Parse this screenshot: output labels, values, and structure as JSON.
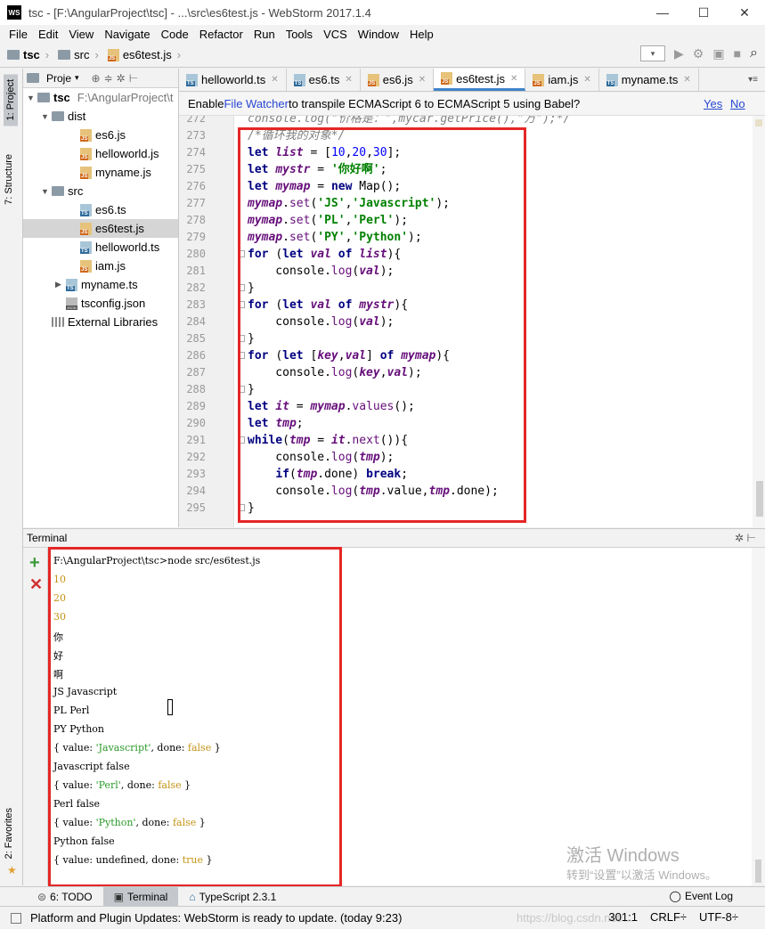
{
  "window": {
    "logo": "WS",
    "title": "tsc - [F:\\AngularProject\\tsc] - ...\\src\\es6test.js - WebStorm 2017.1.4",
    "minimize": "—",
    "maximize": "☐",
    "close": "✕"
  },
  "menu": [
    "File",
    "Edit",
    "View",
    "Navigate",
    "Code",
    "Refactor",
    "Run",
    "Tools",
    "VCS",
    "Window",
    "Help"
  ],
  "breadcrumb": [
    "tsc",
    "src",
    "es6test.js"
  ],
  "left_strip": {
    "project": "1: Project",
    "structure": "7: Structure",
    "favorites": "2: Favorites"
  },
  "project": {
    "header": "Proje",
    "root_name": "tsc",
    "root_path": "F:\\AngularProject\\t",
    "tree": [
      {
        "label": "dist",
        "type": "folder",
        "indent": 1,
        "arrow": "▼"
      },
      {
        "label": "es6.js",
        "type": "js",
        "indent": 3,
        "arrow": ""
      },
      {
        "label": "helloworld.js",
        "type": "js",
        "indent": 3,
        "arrow": ""
      },
      {
        "label": "myname.js",
        "type": "js",
        "indent": 3,
        "arrow": ""
      },
      {
        "label": "src",
        "type": "folder",
        "indent": 1,
        "arrow": "▼"
      },
      {
        "label": "es6.ts",
        "type": "ts",
        "indent": 3,
        "arrow": ""
      },
      {
        "label": "es6test.js",
        "type": "js",
        "indent": 3,
        "arrow": "",
        "selected": true
      },
      {
        "label": "helloworld.ts",
        "type": "ts",
        "indent": 3,
        "arrow": ""
      },
      {
        "label": "iam.js",
        "type": "js",
        "indent": 3,
        "arrow": ""
      },
      {
        "label": "myname.ts",
        "type": "ts",
        "indent": 2,
        "arrow": "▶"
      },
      {
        "label": "tsconfig.json",
        "type": "json",
        "indent": 2,
        "arrow": ""
      },
      {
        "label": "External Libraries",
        "type": "lib",
        "indent": 1,
        "arrow": ""
      }
    ]
  },
  "tabs": [
    {
      "label": "helloworld.ts",
      "type": "ts",
      "active": false
    },
    {
      "label": "es6.ts",
      "type": "ts",
      "active": false
    },
    {
      "label": "es6.js",
      "type": "js",
      "active": false
    },
    {
      "label": "es6test.js",
      "type": "js",
      "active": true
    },
    {
      "label": "iam.js",
      "type": "js",
      "active": false
    },
    {
      "label": "myname.ts",
      "type": "ts",
      "active": false
    }
  ],
  "tab_more": "▾≡",
  "notification": {
    "prefix": "Enable ",
    "link": "File Watcher",
    "suffix": " to transpile ECMAScript 6 to ECMAScript 5 using Babel?",
    "yes": "Yes",
    "no": "No"
  },
  "code": [
    {
      "n": "272",
      "tokens": [
        [
          "cmt",
          "console.log(\"价格是：\",mycar.getPrice(),\"万\");*/"
        ]
      ]
    },
    {
      "n": "273",
      "tokens": [
        [
          "cmt",
          "/*循环我的对象*/"
        ]
      ]
    },
    {
      "n": "274",
      "tokens": [
        [
          "kw",
          "let "
        ],
        [
          "var",
          "list"
        ],
        [
          "plain",
          " = ["
        ],
        [
          "num",
          "10"
        ],
        [
          "plain",
          ","
        ],
        [
          "num",
          "20"
        ],
        [
          "plain",
          ","
        ],
        [
          "num",
          "30"
        ],
        [
          "plain",
          "];"
        ]
      ]
    },
    {
      "n": "275",
      "tokens": [
        [
          "kw",
          "let "
        ],
        [
          "var",
          "mystr"
        ],
        [
          "plain",
          " = "
        ],
        [
          "str",
          "'你好啊'"
        ],
        [
          "plain",
          ";"
        ]
      ]
    },
    {
      "n": "276",
      "tokens": [
        [
          "kw",
          "let "
        ],
        [
          "var",
          "mymap"
        ],
        [
          "plain",
          " = "
        ],
        [
          "kw",
          "new "
        ],
        [
          "plain",
          "Map();"
        ]
      ]
    },
    {
      "n": "277",
      "tokens": [
        [
          "var",
          "mymap"
        ],
        [
          "plain",
          "."
        ],
        [
          "fn",
          "set"
        ],
        [
          "plain",
          "("
        ],
        [
          "str",
          "'JS'"
        ],
        [
          "plain",
          ","
        ],
        [
          "str",
          "'Javascript'"
        ],
        [
          "plain",
          ");"
        ]
      ]
    },
    {
      "n": "278",
      "tokens": [
        [
          "var",
          "mymap"
        ],
        [
          "plain",
          "."
        ],
        [
          "fn",
          "set"
        ],
        [
          "plain",
          "("
        ],
        [
          "str",
          "'PL'"
        ],
        [
          "plain",
          ","
        ],
        [
          "str",
          "'Perl'"
        ],
        [
          "plain",
          ");"
        ]
      ]
    },
    {
      "n": "279",
      "tokens": [
        [
          "var",
          "mymap"
        ],
        [
          "plain",
          "."
        ],
        [
          "fn",
          "set"
        ],
        [
          "plain",
          "("
        ],
        [
          "str",
          "'PY'"
        ],
        [
          "plain",
          ","
        ],
        [
          "str",
          "'Python'"
        ],
        [
          "plain",
          ");"
        ]
      ]
    },
    {
      "n": "280",
      "tokens": [
        [
          "kw",
          "for "
        ],
        [
          "plain",
          "("
        ],
        [
          "kw",
          "let "
        ],
        [
          "var",
          "val"
        ],
        [
          "kw",
          " of "
        ],
        [
          "var",
          "list"
        ],
        [
          "plain",
          "){"
        ]
      ],
      "fold": true
    },
    {
      "n": "281",
      "tokens": [
        [
          "plain",
          "    console."
        ],
        [
          "fn",
          "log"
        ],
        [
          "plain",
          "("
        ],
        [
          "var",
          "val"
        ],
        [
          "plain",
          ");"
        ]
      ]
    },
    {
      "n": "282",
      "tokens": [
        [
          "plain",
          "}"
        ]
      ],
      "fold": true
    },
    {
      "n": "283",
      "tokens": [
        [
          "kw",
          "for "
        ],
        [
          "plain",
          "("
        ],
        [
          "kw",
          "let "
        ],
        [
          "var",
          "val"
        ],
        [
          "kw",
          " of "
        ],
        [
          "var",
          "mystr"
        ],
        [
          "plain",
          "){"
        ]
      ],
      "fold": true
    },
    {
      "n": "284",
      "tokens": [
        [
          "plain",
          "    console."
        ],
        [
          "fn",
          "log"
        ],
        [
          "plain",
          "("
        ],
        [
          "var",
          "val"
        ],
        [
          "plain",
          ");"
        ]
      ]
    },
    {
      "n": "285",
      "tokens": [
        [
          "plain",
          "}"
        ]
      ],
      "fold": true
    },
    {
      "n": "286",
      "tokens": [
        [
          "kw",
          "for "
        ],
        [
          "plain",
          "("
        ],
        [
          "kw",
          "let "
        ],
        [
          "plain",
          "["
        ],
        [
          "var",
          "key"
        ],
        [
          "plain",
          ","
        ],
        [
          "var",
          "val"
        ],
        [
          "plain",
          "]"
        ],
        [
          "kw",
          " of "
        ],
        [
          "var",
          "mymap"
        ],
        [
          "plain",
          "){"
        ]
      ],
      "fold": true
    },
    {
      "n": "287",
      "tokens": [
        [
          "plain",
          "    console."
        ],
        [
          "fn",
          "log"
        ],
        [
          "plain",
          "("
        ],
        [
          "var",
          "key"
        ],
        [
          "plain",
          ","
        ],
        [
          "var",
          "val"
        ],
        [
          "plain",
          ");"
        ]
      ]
    },
    {
      "n": "288",
      "tokens": [
        [
          "plain",
          "}"
        ]
      ],
      "fold": true
    },
    {
      "n": "289",
      "tokens": [
        [
          "kw",
          "let "
        ],
        [
          "var",
          "it"
        ],
        [
          "plain",
          " = "
        ],
        [
          "var",
          "mymap"
        ],
        [
          "plain",
          "."
        ],
        [
          "fn",
          "values"
        ],
        [
          "plain",
          "();"
        ]
      ]
    },
    {
      "n": "290",
      "tokens": [
        [
          "kw",
          "let "
        ],
        [
          "var",
          "tmp"
        ],
        [
          "plain",
          ";"
        ]
      ]
    },
    {
      "n": "291",
      "tokens": [
        [
          "kw",
          "while"
        ],
        [
          "plain",
          "("
        ],
        [
          "var",
          "tmp"
        ],
        [
          "plain",
          " = "
        ],
        [
          "var",
          "it"
        ],
        [
          "plain",
          "."
        ],
        [
          "fn",
          "next"
        ],
        [
          "plain",
          "()){"
        ]
      ],
      "fold": true
    },
    {
      "n": "292",
      "tokens": [
        [
          "plain",
          "    console."
        ],
        [
          "fn",
          "log"
        ],
        [
          "plain",
          "("
        ],
        [
          "var",
          "tmp"
        ],
        [
          "plain",
          ");"
        ]
      ]
    },
    {
      "n": "293",
      "tokens": [
        [
          "plain",
          "    "
        ],
        [
          "kw",
          "if"
        ],
        [
          "plain",
          "("
        ],
        [
          "var",
          "tmp"
        ],
        [
          "plain",
          ".done) "
        ],
        [
          "kw",
          "break"
        ],
        [
          "plain",
          ";"
        ]
      ]
    },
    {
      "n": "294",
      "tokens": [
        [
          "plain",
          "    console."
        ],
        [
          "fn",
          "log"
        ],
        [
          "plain",
          "("
        ],
        [
          "var",
          "tmp"
        ],
        [
          "plain",
          ".value,"
        ],
        [
          "var",
          "tmp"
        ],
        [
          "plain",
          ".done);"
        ]
      ]
    },
    {
      "n": "295",
      "tokens": [
        [
          "plain",
          "}"
        ]
      ],
      "fold": true
    }
  ],
  "terminal": {
    "title": "Terminal",
    "header_icons": "✲ ⊢",
    "add": "+",
    "close": "✕",
    "lines": [
      [
        [
          "plain",
          "F:\\AngularProject\\tsc>node src/es6test.js"
        ]
      ],
      [
        [
          "num",
          "10"
        ]
      ],
      [
        [
          "num",
          "20"
        ]
      ],
      [
        [
          "num",
          "30"
        ]
      ],
      [
        [
          "plain",
          "你"
        ]
      ],
      [
        [
          "plain",
          "好"
        ]
      ],
      [
        [
          "plain",
          "啊"
        ]
      ],
      [
        [
          "plain",
          "JS Javascript"
        ]
      ],
      [
        [
          "plain",
          "PL Perl"
        ]
      ],
      [
        [
          "plain",
          "PY Python"
        ]
      ],
      [
        [
          "plain",
          "{ value: "
        ],
        [
          "str",
          "'Javascript'"
        ],
        [
          "plain",
          ", done: "
        ],
        [
          "bool",
          "false"
        ],
        [
          "plain",
          " }"
        ]
      ],
      [
        [
          "plain",
          "Javascript false"
        ]
      ],
      [
        [
          "plain",
          "{ value: "
        ],
        [
          "str",
          "'Perl'"
        ],
        [
          "plain",
          ", done: "
        ],
        [
          "bool",
          "false"
        ],
        [
          "plain",
          " }"
        ]
      ],
      [
        [
          "plain",
          "Perl false"
        ]
      ],
      [
        [
          "plain",
          "{ value: "
        ],
        [
          "str",
          "'Python'"
        ],
        [
          "plain",
          ", done: "
        ],
        [
          "bool",
          "false"
        ],
        [
          "plain",
          " }"
        ]
      ],
      [
        [
          "plain",
          "Python false"
        ]
      ],
      [
        [
          "plain",
          "{ value: undefined, done: "
        ],
        [
          "bool",
          "true"
        ],
        [
          "plain",
          " }"
        ]
      ]
    ]
  },
  "watermark": {
    "line1": "激活 Windows",
    "line2": "转到“设置”以激活 Windows。"
  },
  "bottom_tabs": {
    "todo": "6: TODO",
    "terminal": "Terminal",
    "typescript": "TypeScript 2.3.1",
    "event_log": "Event Log"
  },
  "status": {
    "message": "Platform and Plugin Updates: WebStorm is ready to update. (today 9:23)",
    "position": "301:1",
    "line_sep": "CRLF÷",
    "encoding": "UTF-8÷",
    "url_watermark": "https://blog.csdn.net/..."
  }
}
